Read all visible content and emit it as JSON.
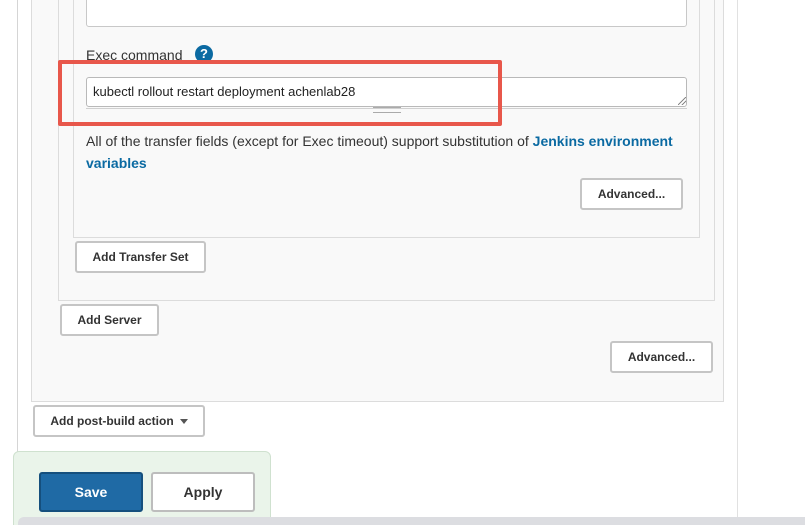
{
  "exec": {
    "label": "Exec command",
    "help": "?",
    "value": "kubectl rollout restart deployment achenlab28"
  },
  "info": {
    "text": "All of the transfer fields (except for Exec timeout) support substitution of ",
    "link": "Jenkins environment variables"
  },
  "buttons": {
    "advanced_transfer": "Advanced...",
    "add_transfer_set": "Add Transfer Set",
    "add_server": "Add Server",
    "advanced_server": "Advanced...",
    "add_post_build": "Add post-build action",
    "save": "Save",
    "apply": "Apply"
  },
  "colors": {
    "highlight": "#e8574b",
    "primary": "#1f6aa5",
    "link": "#0b6aa2"
  }
}
